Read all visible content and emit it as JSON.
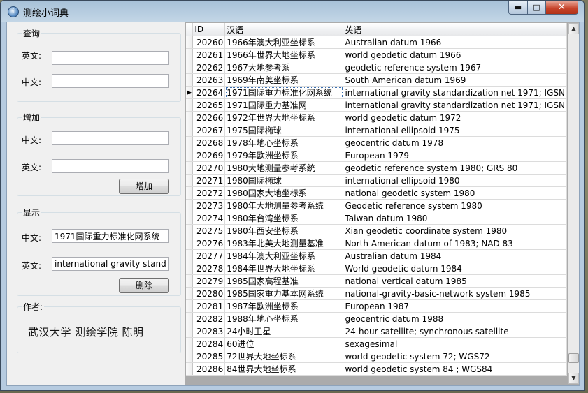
{
  "window": {
    "title": "测绘小词典",
    "min_glyph": "▬",
    "max_glyph": "□",
    "close_glyph": "✕"
  },
  "query": {
    "title": "查询",
    "en_label": "英文:",
    "zh_label": "中文:",
    "en_value": "",
    "zh_value": ""
  },
  "add": {
    "title": "增加",
    "zh_label": "中文:",
    "en_label": "英文:",
    "zh_value": "",
    "en_value": "",
    "button": "增加"
  },
  "display": {
    "title": "显示",
    "zh_label": "中文:",
    "en_label": "英文:",
    "zh_value": "1971国际重力标准化网系统",
    "en_value": "international gravity standardizatic",
    "button": "删除"
  },
  "author": {
    "title": "作者:",
    "text": "武汉大学 测绘学院   陈明"
  },
  "table": {
    "columns": [
      "ID",
      "汉语",
      "英语"
    ],
    "current_row_marker": "▶",
    "current_row": 4,
    "rows": [
      {
        "id": "20260",
        "zh": "1966年澳大利亚坐标系",
        "en": "Australian datum 1966"
      },
      {
        "id": "20261",
        "zh": "1966年世界大地坐标系",
        "en": "world geodetic datum 1966"
      },
      {
        "id": "20262",
        "zh": "1967大地参考系",
        "en": "geodetic reference system 1967"
      },
      {
        "id": "20263",
        "zh": "1969年南美坐标系",
        "en": "South American datum 1969"
      },
      {
        "id": "20264",
        "zh": "1971国际重力标准化网系统",
        "en": "international gravity standardization net 1971; IGSN"
      },
      {
        "id": "20265",
        "zh": "1971国际重力基准网",
        "en": "international gravity standardization net 1971; IGSN"
      },
      {
        "id": "20266",
        "zh": "1972年世界大地坐标系",
        "en": "world geodetic datum 1972"
      },
      {
        "id": "20267",
        "zh": "1975国际椭球",
        "en": "international ellipsoid 1975"
      },
      {
        "id": "20268",
        "zh": "1978年地心坐标系",
        "en": "geocentric datum 1978"
      },
      {
        "id": "20269",
        "zh": "1979年欧洲坐标系",
        "en": "European 1979"
      },
      {
        "id": "20270",
        "zh": "1980大地测量参考系统",
        "en": "geodetic reference system 1980; GRS 80"
      },
      {
        "id": "20271",
        "zh": "1980国际椭球",
        "en": "international ellipsoid 1980"
      },
      {
        "id": "20272",
        "zh": "1980国家大地坐标系",
        "en": "national geodetic system 1980"
      },
      {
        "id": "20273",
        "zh": "1980年大地测量参考系统",
        "en": "Geodetic reference system 1980"
      },
      {
        "id": "20274",
        "zh": "1980年台湾坐标系",
        "en": "Taiwan datum 1980"
      },
      {
        "id": "20275",
        "zh": "1980年西安坐标系",
        "en": "Xian geodetic coordinate system 1980"
      },
      {
        "id": "20276",
        "zh": "1983年北美大地测量基准",
        "en": "North American datum of 1983; NAD 83"
      },
      {
        "id": "20277",
        "zh": "1984年澳大利亚坐标系",
        "en": "Australian datum 1984"
      },
      {
        "id": "20278",
        "zh": "1984年世界大地坐标系",
        "en": "World geodetic datum 1984"
      },
      {
        "id": "20279",
        "zh": "1985国家高程基准",
        "en": "national vertical datum 1985"
      },
      {
        "id": "20280",
        "zh": "1985国家重力基本网系统",
        "en": "national-gravity-basic-network system 1985"
      },
      {
        "id": "20281",
        "zh": "1987年欧洲坐标系",
        "en": "European 1987"
      },
      {
        "id": "20282",
        "zh": "1988年地心坐标系",
        "en": "geocentric datum 1988"
      },
      {
        "id": "20283",
        "zh": "24小时卫星",
        "en": "24-hour satellite; synchronous satellite"
      },
      {
        "id": "20284",
        "zh": "60进位",
        "en": "sexagesimal"
      },
      {
        "id": "20285",
        "zh": "72世界大地坐标系",
        "en": "world geodetic system 72; WGS72"
      },
      {
        "id": "20286",
        "zh": "84世界大地坐标系",
        "en": "world geodetic system 84 ; WGS84"
      }
    ]
  },
  "scrollbar": {
    "up_glyph": "▲",
    "down_glyph": "▼",
    "position": 0.97
  }
}
